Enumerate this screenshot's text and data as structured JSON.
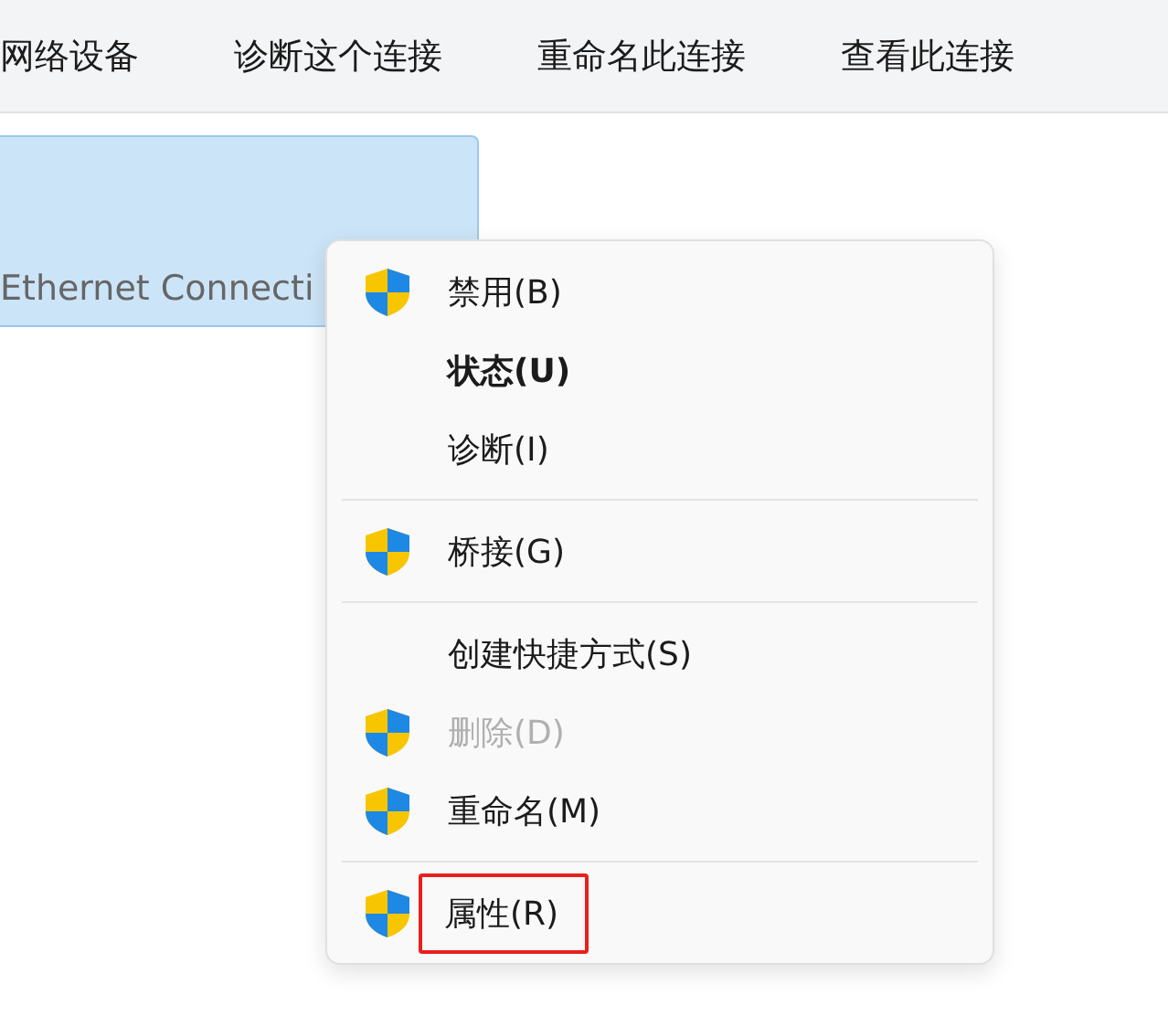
{
  "toolbar": {
    "items": [
      {
        "label": "网络设备"
      },
      {
        "label": "诊断这个连接"
      },
      {
        "label": "重命名此连接"
      },
      {
        "label": "查看此连接"
      }
    ]
  },
  "connection": {
    "name": "Ethernet Connecti",
    "selected": true
  },
  "context_menu": {
    "items": [
      {
        "kind": "item",
        "label": "禁用(B)",
        "shield": true,
        "bold": false,
        "disabled": false,
        "highlighted": false
      },
      {
        "kind": "item",
        "label": "状态(U)",
        "shield": false,
        "bold": true,
        "disabled": false,
        "highlighted": false
      },
      {
        "kind": "item",
        "label": "诊断(I)",
        "shield": false,
        "bold": false,
        "disabled": false,
        "highlighted": false
      },
      {
        "kind": "separator"
      },
      {
        "kind": "item",
        "label": "桥接(G)",
        "shield": true,
        "bold": false,
        "disabled": false,
        "highlighted": false
      },
      {
        "kind": "separator"
      },
      {
        "kind": "item",
        "label": "创建快捷方式(S)",
        "shield": false,
        "bold": false,
        "disabled": false,
        "highlighted": false
      },
      {
        "kind": "item",
        "label": "删除(D)",
        "shield": true,
        "bold": false,
        "disabled": true,
        "highlighted": false
      },
      {
        "kind": "item",
        "label": "重命名(M)",
        "shield": true,
        "bold": false,
        "disabled": false,
        "highlighted": false
      },
      {
        "kind": "separator"
      },
      {
        "kind": "item",
        "label": "属性(R)",
        "shield": true,
        "bold": false,
        "disabled": false,
        "highlighted": true
      }
    ]
  }
}
